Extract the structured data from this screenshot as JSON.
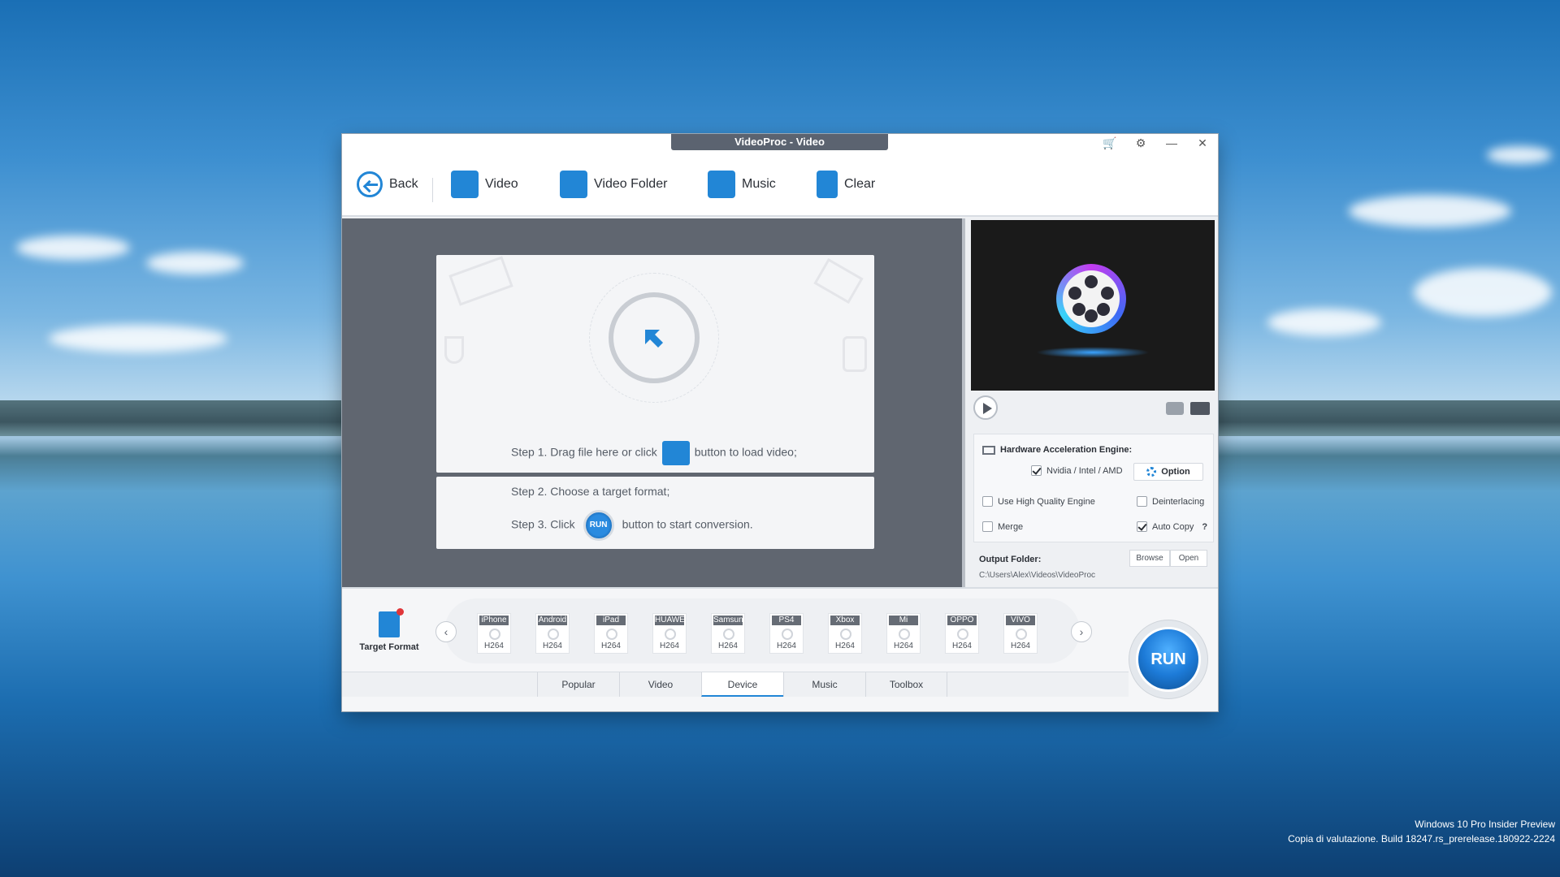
{
  "window": {
    "title": "VideoProc - Video"
  },
  "titlebar": {
    "icons": [
      "cart-icon",
      "settings-icon",
      "minimize-icon",
      "close-icon"
    ]
  },
  "toolbar": {
    "back_label": "Back",
    "video_label": "Video",
    "video_folder_label": "Video Folder",
    "music_label": "Music",
    "clear_label": "Clear"
  },
  "drop": {
    "step1_before": "Step 1. Drag file here or click",
    "step1_after": "button to load video;",
    "step2": "Step 2. Choose a target format;",
    "step3_before": "Step 3. Click",
    "step3_after": "button to start conversion.",
    "run_small": "RUN"
  },
  "settings": {
    "hw_title": "Hardware Acceleration Engine:",
    "nvidia_label": "Nvidia / Intel / AMD",
    "nvidia_checked": true,
    "option_label": "Option",
    "hq_label": "Use High Quality Engine",
    "hq_checked": false,
    "deint_label": "Deinterlacing",
    "deint_checked": false,
    "merge_label": "Merge",
    "merge_checked": false,
    "autocopy_label": "Auto Copy",
    "autocopy_checked": true,
    "help": "?",
    "output_label": "Output Folder:",
    "output_path": "C:\\Users\\Alex\\Videos\\VideoProc",
    "browse_label": "Browse",
    "open_label": "Open"
  },
  "bottom": {
    "target_format_label": "Target Format",
    "devices": [
      {
        "name": "iPhone",
        "codec": "H264"
      },
      {
        "name": "Android",
        "codec": "H264"
      },
      {
        "name": "iPad",
        "codec": "H264"
      },
      {
        "name": "HUAWEI",
        "codec": "H264"
      },
      {
        "name": "Samsung",
        "codec": "H264"
      },
      {
        "name": "PS4",
        "codec": "H264"
      },
      {
        "name": "Xbox",
        "codec": "H264"
      },
      {
        "name": "Mi",
        "codec": "H264"
      },
      {
        "name": "OPPO",
        "codec": "H264"
      },
      {
        "name": "VIVO",
        "codec": "H264"
      }
    ],
    "tabs": [
      "Popular",
      "Video",
      "Device",
      "Music",
      "Toolbox"
    ],
    "active_tab": "Device",
    "run_label": "RUN"
  },
  "desktop": {
    "watermark_line1": "Windows 10 Pro Insider Preview",
    "watermark_line2": "Copia di valutazione. Build 18247.rs_prerelease.180922-2224"
  },
  "colors": {
    "accent": "#2286d6",
    "dark_panel": "#606670",
    "title_tab": "#5b6370"
  }
}
